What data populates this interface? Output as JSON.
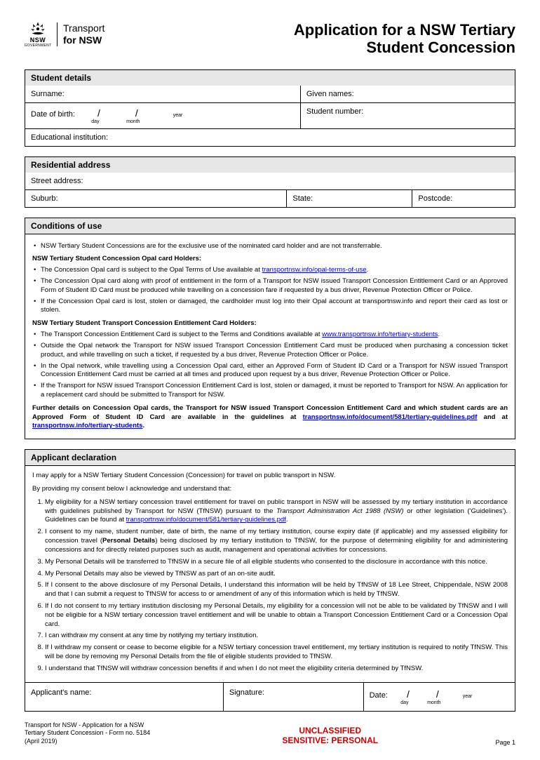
{
  "header": {
    "org_line1": "Transport",
    "org_line2": "for NSW",
    "nsw": "NSW",
    "gov": "GOVERNMENT",
    "title_line1": "Application for a NSW Tertiary",
    "title_line2": "Student Concession"
  },
  "sections": {
    "student": "Student details",
    "address": "Residential address",
    "conditions": "Conditions of use",
    "declaration": "Applicant declaration"
  },
  "fields": {
    "surname": "Surname:",
    "given": "Given names:",
    "dob": "Date of birth:",
    "day": "day",
    "month": "month",
    "year": "year",
    "studentno": "Student number:",
    "inst": "Educational institution:",
    "street": "Street address:",
    "suburb": "Suburb:",
    "state": "State:",
    "postcode": "Postcode:",
    "appname": "Applicant's name:",
    "signature": "Signature:",
    "date": "Date:"
  },
  "conditions": {
    "intro": "NSW Tertiary Student Concessions are for the exclusive use of the nominated card holder and are not transferrable.",
    "sub1": "NSW Tertiary Student Concession Opal card Holders:",
    "c1": "The Concession Opal card is subject to the Opal Terms of Use available at ",
    "c1_link": "transportnsw.info/opal-terms-of-use",
    "c1_end": ".",
    "c2": "The Concession Opal card along with proof of entitlement in the form of a Transport for NSW issued Transport Concession Entitlement Card or an Approved Form of Student ID Card must be produced while travelling on a concession fare if requested by a bus driver, Revenue Protection Officer or Police.",
    "c3": "If the Concession Opal card is lost, stolen or damaged, the cardholder must log into their Opal account at transportnsw.info and report their card as lost or stolen.",
    "sub2": "NSW Tertiary Student Transport Concession Entitlement Card Holders:",
    "c4": "The Transport Concession Entitlement Card is subject to the Terms and Conditions available at ",
    "c4_link": "www.transportnsw.info/tertiary-students",
    "c4_end": ".",
    "c5": "Outside the Opal network the Transport for NSW issued Transport Concession Entitlement Card must be produced when purchasing a concession ticket product, and while travelling on such a ticket, if requested by a bus driver, Revenue Protection Officer or Police.",
    "c6": "In the Opal network, while travelling using a Concession Opal card, either an Approved Form of Student ID Card or a Transport for NSW issued Transport Concession Entitlement Card must be carried at all times and produced upon request by a bus driver, Revenue Protection Officer or Police.",
    "c7": "If the Transport for NSW issued Transport Concession Entitlement Card is lost, stolen or damaged, it must be reported to Transport for NSW. An application for a replacement card should be submitted to Transport for NSW.",
    "further1": "Further details on Concession Opal cards, the Transport for NSW issued Transport Concession Entitlement Card and which student cards are an Approved Form of Student ID Card are available in the guidelines at ",
    "further_link1": "transportnsw.info/document/581/tertiary-guidelines.pdf",
    "further_mid": " and at ",
    "further_link2": "transportnsw.info/tertiary-students",
    "further_end": "."
  },
  "declaration": {
    "intro": "I may apply for a NSW Tertiary Student Concession (Concession) for travel on public transport in NSW.",
    "ack": "By providing my consent below I acknowledge and understand that:",
    "d1a": "My eligibility for a NSW tertiary concession travel entitlement for travel on public transport in NSW will be assessed by my tertiary institution in accordance with guidelines published by Transport for NSW (TfNSW) pursuant to the ",
    "d1_italic": "Transport Administration Act 1988 (NSW)",
    "d1b": " or other legislation ('Guidelines'). Guidelines can be found at ",
    "d1_link": "transportnsw.info/document/581/tertiary-guidelines.pdf",
    "d1_end": ".",
    "d2a": "I consent to my name, student number, date of birth, the name of my tertiary institution, course expiry date (if applicable) and my assessed eligibility for concession travel (",
    "d2_bold": "Personal Details",
    "d2b": ") being disclosed by my tertiary institution to TfNSW, for the purpose of determining eligibility for and administering concessions and for directly related purposes such as audit, management and operational activities for concessions.",
    "d3": "My Personal Details will be transferred to TfNSW in a secure file of all eligible students who consented to the disclosure in accordance with this notice.",
    "d4": "My Personal Details may also be viewed by TfNSW as part of an on-site audit.",
    "d5": "If I consent to the above disclosure of my Personal Details, I understand this information will be held by TfNSW of 18 Lee Street, Chippendale, NSW 2008 and that I can submit a request to TfNSW for access to or amendment of any of this information which is held by TfNSW.",
    "d6": "If I do not consent to my tertiary institution disclosing my Personal Details, my eligibility for a concession will not be able to be validated by TfNSW and I will not be eligible for a NSW tertiary concession travel entitlement and will be unable to obtain a Transport Concession Entitlement Card or a Concession Opal card.",
    "d7": "I can withdraw my consent at any time by notifying my tertiary institution.",
    "d8": "If I withdraw my consent or cease to become eligible for a NSW tertiary concession travel entitlement, my tertiary institution is required to notify TfNSW. This will be done by removing my Personal Details from the file of eligible students provided to TfNSW.",
    "d9": "I understand that TfNSW will withdraw concession benefits if and when I do not meet the eligibility criteria determined by TfNSW."
  },
  "footer": {
    "left": "Transport for NSW - Application for a NSW Tertiary Student Concession - Form no. 5184 (April 2019)",
    "center1": "UNCLASSIFIED",
    "center2": "SENSITIVE: PERSONAL",
    "right": "Page 1"
  }
}
